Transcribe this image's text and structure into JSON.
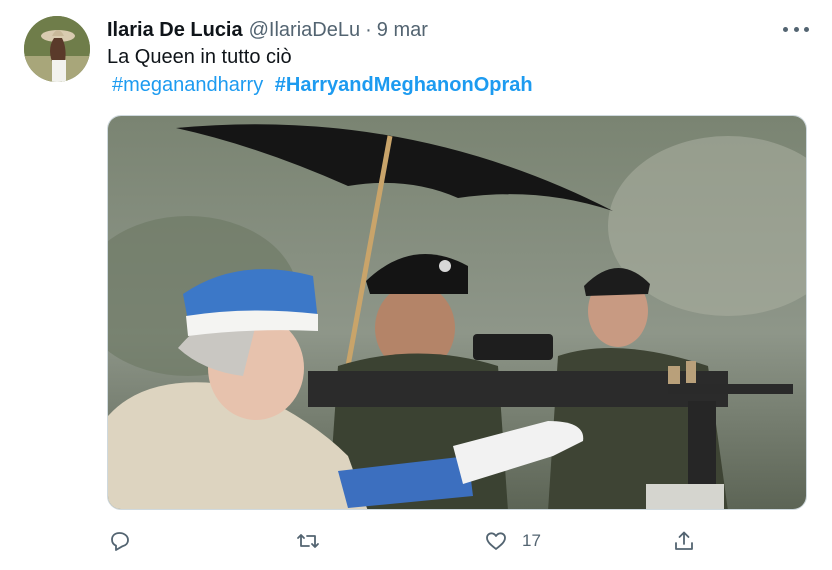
{
  "tweet": {
    "author_name": "Ilaria De Lucia",
    "handle": "@IlariaDeLu",
    "separator": "·",
    "date": "9 mar",
    "text": "La Queen in tutto ciò",
    "hashtags": [
      "#meganandharry",
      "#HarryandMeghanonOprah"
    ]
  },
  "actions": {
    "reply_count": "",
    "retweet_count": "",
    "like_count": "17"
  },
  "icons": {
    "more": "more-horizontal-icon",
    "reply": "reply-icon",
    "retweet": "retweet-icon",
    "like": "heart-icon",
    "share": "share-icon"
  },
  "colors": {
    "link": "#1d9bf0",
    "secondary_text": "#536471",
    "primary_text": "#0f1419"
  }
}
